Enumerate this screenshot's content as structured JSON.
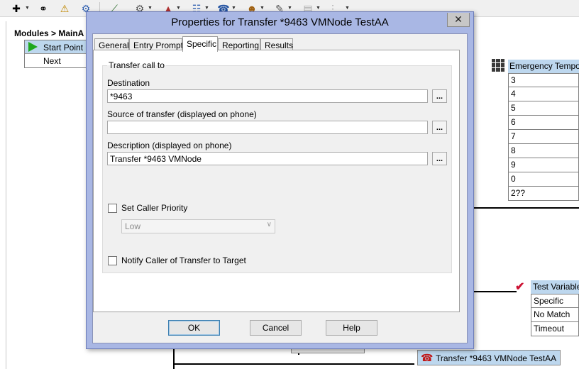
{
  "dialog": {
    "title": "Properties for Transfer *9463 VMNode TestAA",
    "close_glyph": "✕",
    "tabs": [
      "General",
      "Entry Prompts",
      "Specific",
      "Reporting",
      "Results"
    ],
    "active_tab": "Specific",
    "group_label": "Transfer call to",
    "destination_label": "Destination",
    "destination_value": "*9463",
    "source_label": "Source of transfer (displayed on phone)",
    "source_value": "",
    "description_label": "Description (displayed on phone)",
    "description_value": "Transfer *9463 VMNode",
    "browse_label": "...",
    "set_priority_label": "Set Caller Priority",
    "set_priority_checked": false,
    "priority_value": "Low",
    "notify_label": "Notify Caller of Transfer to Target",
    "notify_checked": false,
    "ok_label": "OK",
    "cancel_label": "Cancel",
    "help_label": "Help"
  },
  "background": {
    "breadcrumb": "Modules > MainA",
    "start_node": {
      "title": "Start Point",
      "next": "Next"
    },
    "emergency_node": {
      "title": "Emergency Tempora",
      "items": [
        "3",
        "4",
        "5",
        "6",
        "7",
        "8",
        "9",
        "0",
        "2??"
      ]
    },
    "test_variable_node": {
      "title": "Test Variable",
      "items": [
        "Specific",
        "No Match",
        "Timeout"
      ]
    },
    "transfer_node": "Transfer *9463 VMNode TestAA"
  },
  "colors": {
    "dialog_frame": "#a9b7e4",
    "node_highlight": "#bdd7ee",
    "start_icon": "#1fa81f"
  }
}
